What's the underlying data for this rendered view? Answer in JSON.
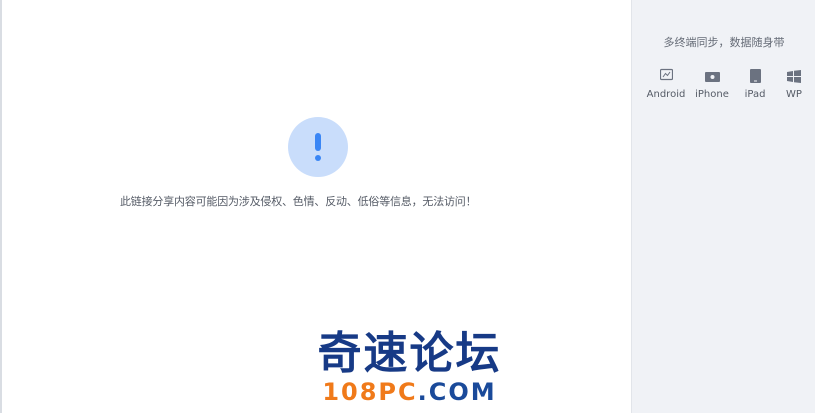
{
  "main": {
    "notice_text": "此链接分享内容可能因为涉及侵权、色情、反动、低俗等信息，无法访问！"
  },
  "sidebar": {
    "title": "多终端同步，数据随身带",
    "platforms": [
      {
        "label": "Android",
        "icon": "android-icon"
      },
      {
        "label": "iPhone",
        "icon": "iphone-icon"
      },
      {
        "label": "iPad",
        "icon": "ipad-icon"
      },
      {
        "label": "WP",
        "icon": "windows-phone-icon"
      }
    ]
  },
  "watermark": {
    "title": "奇速论坛",
    "sub_num": "108PC",
    "sub_txt": ".COM"
  },
  "colors": {
    "accent": "#3a86f5",
    "alert_bg": "#c9ddfb",
    "sidebar_bg": "#f0f2f6",
    "watermark_blue": "#173a86",
    "watermark_orange": "#f07a1a"
  }
}
